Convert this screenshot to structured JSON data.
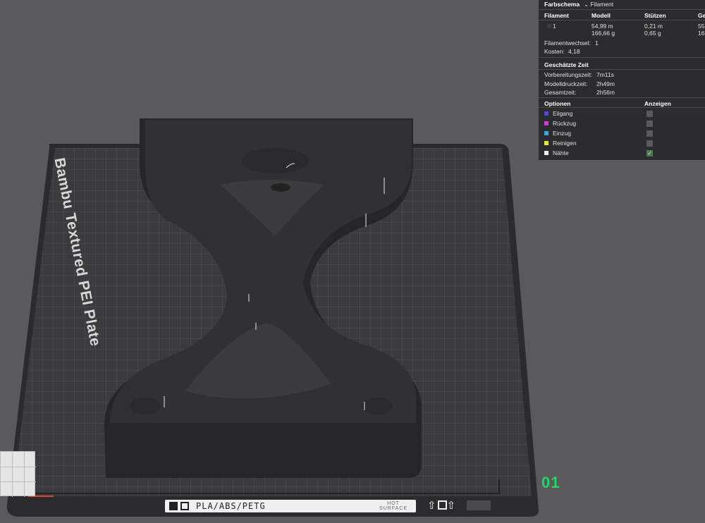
{
  "plate": {
    "name": "Bambu Textured PEI Plate",
    "material_label": "PLA/ABS/PETG",
    "surface_label": "HOT\nSURFACE",
    "number": "01"
  },
  "panel": {
    "color_scheme_label": "Farbschema",
    "color_scheme_value": "Filament",
    "columns": {
      "filament": "Filament",
      "model": "Modell",
      "supports": "Stützen",
      "total": "Ge"
    },
    "filament_row": {
      "id": "1",
      "model_length": "54,99 m",
      "model_weight": "166,66 g",
      "support_length": "0,21 m",
      "support_weight": "0,65 g",
      "total_length": "55",
      "total_weight": "16"
    },
    "filament_changes_label": "Filamentwechsel:",
    "filament_changes_value": "1",
    "cost_label": "Kosten:",
    "cost_value": "4,18",
    "time_header": "Geschätzte Zeit",
    "prep_label": "Vorbereitungszeit:",
    "prep_value": "7m11s",
    "model_time_label": "Modelldruckzeit:",
    "model_time_value": "2h49m",
    "total_time_label": "Gesamtzeit:",
    "total_time_value": "2h56m",
    "options_header": "Optionen",
    "display_header": "Anzeigen",
    "options": [
      {
        "label": "Eilgang",
        "color": "#4a4adb",
        "checked": false
      },
      {
        "label": "Rückzug",
        "color": "#d63ad0",
        "checked": false
      },
      {
        "label": "Einzug",
        "color": "#3aa7d6",
        "checked": false
      },
      {
        "label": "Reinigen",
        "color": "#e8e83a",
        "checked": false
      },
      {
        "label": "Nähte",
        "color": "#eeeeee",
        "checked": true
      }
    ]
  },
  "colors": {
    "plate_surface": "#3b3b3d",
    "model": "#2e2e30",
    "accent_green": "#1fd66a"
  }
}
